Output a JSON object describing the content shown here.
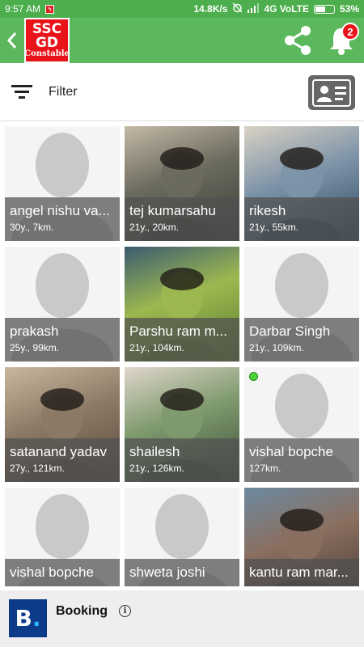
{
  "status_bar": {
    "time": "9:57 AM",
    "network_speed": "14.8K/s",
    "network_type": "4G VoLTE",
    "battery": "53%",
    "notification_icon": "flash-notification-icon"
  },
  "app_bar": {
    "logo": {
      "line1": "SSC",
      "line2": "GD",
      "line3": "Constable"
    },
    "notification_count": "2",
    "colors": {
      "bar": "#5cb85c",
      "status": "#4cae4c",
      "logo": "#e8141a"
    }
  },
  "filter_bar": {
    "label": "Filter"
  },
  "profiles": [
    {
      "name": "angel nishu va...",
      "info": "30y., 7km.",
      "photo": false,
      "online": false
    },
    {
      "name": "tej kumarsahu",
      "info": "21y., 20km.",
      "photo": true,
      "online": false
    },
    {
      "name": "rikesh",
      "info": "21y., 55km.",
      "photo": true,
      "online": false
    },
    {
      "name": "prakash",
      "info": "25y., 99km.",
      "photo": false,
      "online": false
    },
    {
      "name": "Parshu ram m...",
      "info": "21y., 104km.",
      "photo": true,
      "online": false
    },
    {
      "name": "Darbar Singh",
      "info": "21y., 109km.",
      "photo": false,
      "online": false
    },
    {
      "name": "satanand yadav",
      "info": "27y., 121km.",
      "photo": true,
      "online": false
    },
    {
      "name": "shailesh",
      "info": "21y., 126km.",
      "photo": true,
      "online": false
    },
    {
      "name": "vishal bopche",
      "info": "127km.",
      "photo": false,
      "online": true
    },
    {
      "name": "vishal bopche",
      "info": "",
      "photo": false,
      "online": false
    },
    {
      "name": "shweta joshi",
      "info": "",
      "photo": false,
      "online": false
    },
    {
      "name": "kantu ram mar...",
      "info": "",
      "photo": true,
      "online": false
    }
  ],
  "ad": {
    "logo_letter": "B",
    "title": "Booking",
    "info_icon": "i"
  }
}
